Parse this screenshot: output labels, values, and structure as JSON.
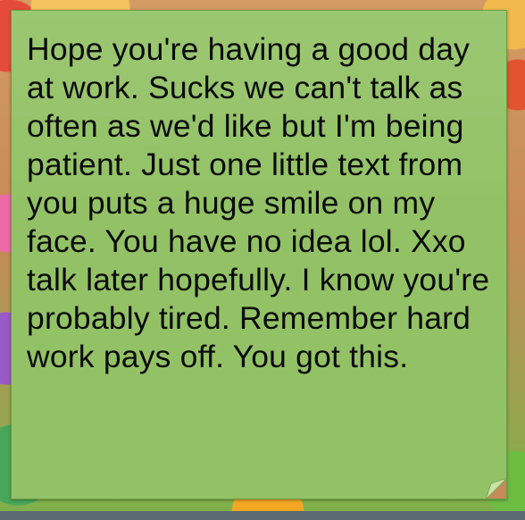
{
  "message": {
    "text": "Hope you're having a good day at work. Sucks we can't talk as often as we'd like but I'm being patient. Just one little text from you puts a huge smile on my face. You have no idea lol. Xxo talk later hopefully. I know you're probably tired. Remember hard work pays off. You got this."
  },
  "colors": {
    "bubble": "#93c266",
    "text": "#0b0b0b"
  }
}
